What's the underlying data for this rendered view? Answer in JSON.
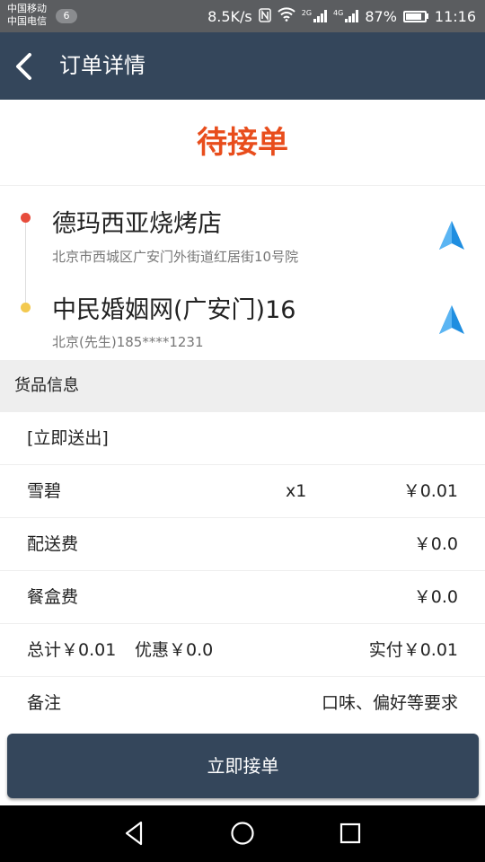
{
  "status_bar": {
    "carrier1": "中国移动",
    "carrier2": "中国电信",
    "notification_count": "6",
    "net_speed": "8.5K/s",
    "nfc_icon": "nfc-icon",
    "wifi_icon": "wifi-icon",
    "sig1_tag": "2G",
    "sig2_tag": "4G",
    "battery": "87%",
    "battery_level": 0.87,
    "time": "11:16"
  },
  "header": {
    "back_icon": "back-arrow-icon",
    "title": "订单详情"
  },
  "order_status": "待接单",
  "colors": {
    "header_bg": "#34465b",
    "status_text": "#e84d1c",
    "pickup_dot": "#e74c3c",
    "dropoff_dot": "#f3c94f",
    "nav_arrow": "#1f8ee0"
  },
  "route": {
    "pickup": {
      "name": "德玛西亚烧烤店",
      "address": "北京市西城区广安门外街道红居街10号院"
    },
    "dropoff": {
      "name": "中民婚姻网(广安门)16",
      "contact": "北京(先生)185****1231"
    }
  },
  "goods": {
    "section_title": "货品信息",
    "tag": "[立即送出]",
    "items": [
      {
        "name": "雪碧",
        "qty": "x1",
        "price": "￥0.01"
      }
    ],
    "delivery_fee_label": "配送费",
    "delivery_fee": "￥0.0",
    "box_fee_label": "餐盒费",
    "box_fee": "￥0.0",
    "total": "总计￥0.01",
    "discount": "优惠￥0.0",
    "paid": "实付￥0.01",
    "remark_label": "备注",
    "remark_value": "口味、偏好等要求"
  },
  "action": {
    "accept_label": "立即接单"
  }
}
